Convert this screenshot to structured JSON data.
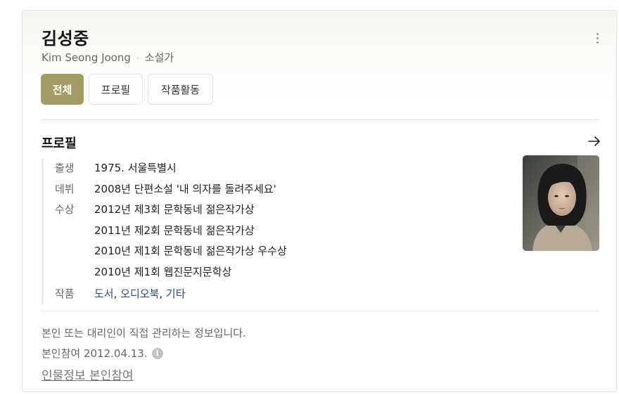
{
  "header": {
    "name": "김성중",
    "romanized": "Kim Seong Joong",
    "occupation": "소설가",
    "more_icon": "more-vertical-icon"
  },
  "tabs": [
    {
      "label": "전체",
      "active": true
    },
    {
      "label": "프로필",
      "active": false
    },
    {
      "label": "작품활동",
      "active": false
    }
  ],
  "profile": {
    "title": "프로필",
    "arrow_icon": "arrow-right-icon",
    "birth_label": "출생",
    "birth_value": "1975. 서울특별시",
    "debut_label": "데뷔",
    "debut_value": "2008년 단편소설 '내 의자를 돌려주세요'",
    "awards_label": "수상",
    "awards": [
      "2012년 제3회 문학동네 젊은작가상",
      "2011년 제2회 문학동네 젊은작가상",
      "2010년 제1회 문학동네 젊은작가상 우수상",
      "2010년 제1회 웹진문지문학상"
    ],
    "works_label": "작품",
    "works": [
      "도서",
      "오디오북",
      "기타"
    ],
    "works_separator": ", "
  },
  "footer": {
    "notice": "본인 또는 대리인이 직접 관리하는 정보입니다.",
    "participation": "본인참여 2012.04.13.",
    "info_icon_glyph": "i",
    "link": "인물정보 본인참여"
  },
  "colors": {
    "accent": "#a29b62",
    "link": "#2c4a8c"
  }
}
